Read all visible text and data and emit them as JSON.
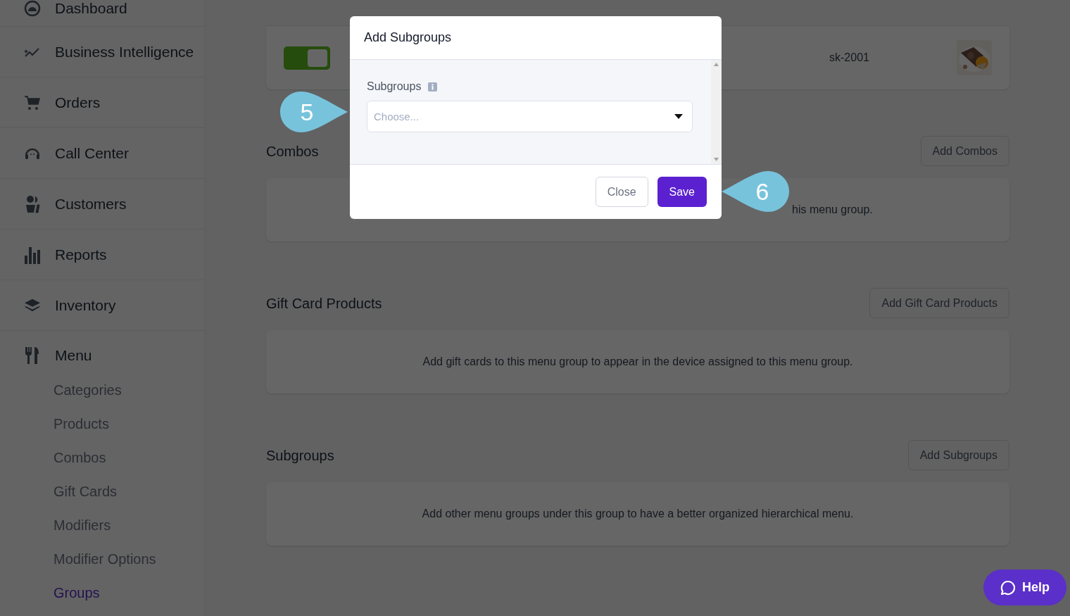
{
  "sidebar": {
    "items": [
      {
        "label": "Dashboard"
      },
      {
        "label": "Business Intelligence"
      },
      {
        "label": "Orders"
      },
      {
        "label": "Call Center"
      },
      {
        "label": "Customers"
      },
      {
        "label": "Reports"
      },
      {
        "label": "Inventory"
      },
      {
        "label": "Menu",
        "expanded": true,
        "children": [
          {
            "label": "Categories",
            "selected": false
          },
          {
            "label": "Products",
            "selected": false
          },
          {
            "label": "Combos",
            "selected": false
          },
          {
            "label": "Gift Cards",
            "selected": false
          },
          {
            "label": "Modifiers",
            "selected": false
          },
          {
            "label": "Modifier Options",
            "selected": false
          },
          {
            "label": "Groups",
            "selected": true
          }
        ]
      }
    ]
  },
  "products_table": {
    "rows": [
      {
        "enabled": true,
        "sku": "sk-2001"
      }
    ]
  },
  "sections": [
    {
      "title": "Combos",
      "button": "Add Combos",
      "message": "his menu group."
    },
    {
      "title": "Gift Card Products",
      "button": "Add Gift Card Products",
      "message": "Add gift cards to this menu group to appear in the device assigned to this menu group."
    },
    {
      "title": "Subgroups",
      "button": "Add Subgroups",
      "message": "Add other menu groups under this group to have a better organized hierarchical menu."
    }
  ],
  "modal": {
    "title": "Add Subgroups",
    "field_label": "Subgroups",
    "placeholder": "Choose...",
    "buttons": [
      {
        "label": "Close",
        "kind": "secondary"
      },
      {
        "label": "Save",
        "kind": "primary"
      }
    ]
  },
  "callouts": [
    {
      "number": "5"
    },
    {
      "number": "6"
    }
  ],
  "help_button": {
    "label": "Help"
  }
}
